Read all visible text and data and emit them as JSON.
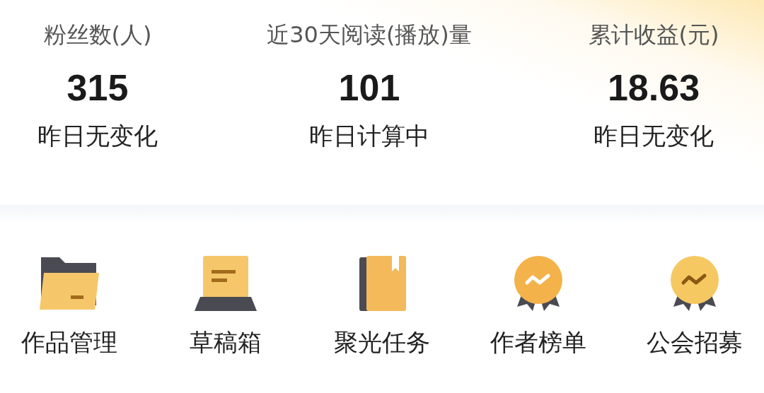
{
  "stats": [
    {
      "label": "粉丝数(人)",
      "value": "315",
      "change": "昨日无变化"
    },
    {
      "label": "近30天阅读(播放)量",
      "value": "101",
      "change": "昨日计算中"
    },
    {
      "label": "累计收益(元)",
      "value": "18.63",
      "change": "昨日无变化"
    }
  ],
  "shortcuts": [
    {
      "kind": "folder",
      "label": "作品管理"
    },
    {
      "kind": "draft",
      "label": "草稿箱"
    },
    {
      "kind": "book",
      "label": "聚光任务"
    },
    {
      "kind": "medal",
      "label": "作者榜单"
    },
    {
      "kind": "badge",
      "label": "公会招募"
    }
  ]
}
